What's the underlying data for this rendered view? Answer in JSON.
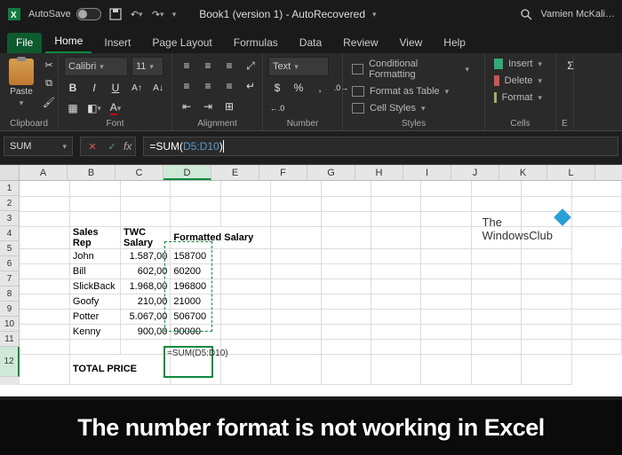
{
  "titlebar": {
    "autosave_label": "AutoSave",
    "doc_title": "Book1 (version 1) - AutoRecovered",
    "user": "Vamien McKali…"
  },
  "tabs": {
    "file": "File",
    "home": "Home",
    "insert": "Insert",
    "page_layout": "Page Layout",
    "formulas": "Formulas",
    "data": "Data",
    "review": "Review",
    "view": "View",
    "help": "Help"
  },
  "ribbon": {
    "paste": "Paste",
    "clipboard": "Clipboard",
    "font_name": "Calibri",
    "font_size": "11",
    "font": "Font",
    "alignment": "Alignment",
    "number_format": "Text",
    "number": "Number",
    "cond_fmt": "Conditional Formatting",
    "fmt_table": "Format as Table",
    "cell_styles": "Cell Styles",
    "styles": "Styles",
    "insert": "Insert",
    "delete": "Delete",
    "format": "Format",
    "cells": "Cells"
  },
  "fbar": {
    "name": "SUM",
    "formula_prefix": "=SUM(",
    "formula_ref": "D5:D10",
    "formula_suffix": ")"
  },
  "columns": [
    "A",
    "B",
    "C",
    "D",
    "E",
    "F",
    "G",
    "H",
    "I",
    "J",
    "K",
    "L"
  ],
  "rows": [
    "1",
    "2",
    "3",
    "4",
    "5",
    "6",
    "7",
    "8",
    "9",
    "10",
    "11",
    "12"
  ],
  "sheet": {
    "r4": {
      "b": "Sales Rep",
      "c": "TWC Salary",
      "d": "Formatted Salary"
    },
    "r5": {
      "b": "John",
      "c": "1.587,00",
      "d": "158700"
    },
    "r6": {
      "b": "Bill",
      "c": "602,00",
      "d": "60200"
    },
    "r7": {
      "b": "SlickBack",
      "c": "1.968,00",
      "d": "196800"
    },
    "r8": {
      "b": "Goofy",
      "c": "210,00",
      "d": "21000"
    },
    "r9": {
      "b": "Potter",
      "c": "5.067,00",
      "d": "506700"
    },
    "r10": {
      "b": "Kenny",
      "c": "900,00",
      "d": "90000"
    },
    "r12": {
      "b": "TOTAL PRICE",
      "d": "=SUM(D5:D10)"
    }
  },
  "logo": {
    "l1": "The",
    "l2": "WindowsClub"
  },
  "overlay": "The number format is not working in Excel"
}
